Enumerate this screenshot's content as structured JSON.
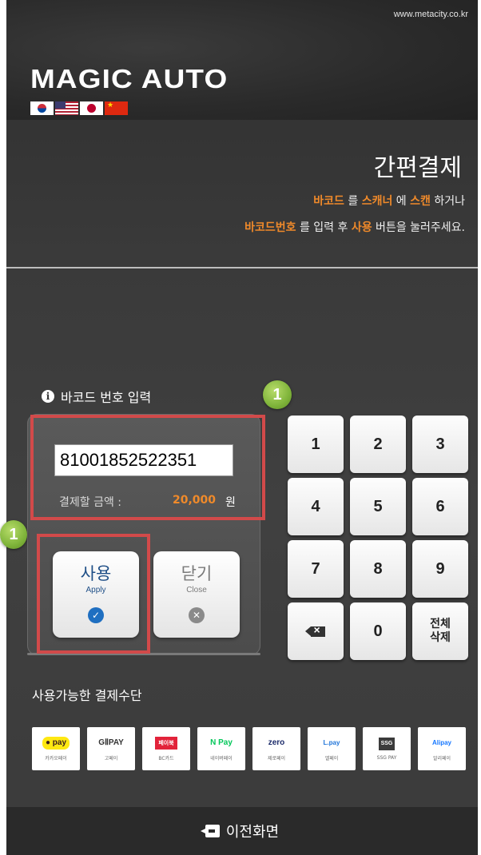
{
  "header": {
    "site_url": "www.metacity.co.kr",
    "logo_text": "MAGIC AUTO",
    "flags": [
      "korea-flag-icon",
      "usa-flag-icon",
      "japan-flag-icon",
      "china-flag-icon"
    ]
  },
  "title": "간편결제",
  "instructions": {
    "line1": {
      "w1": "바코드",
      "t1": " 를 ",
      "w2": "스캐너",
      "t2": " 에 ",
      "w3": "스캔",
      "t3": " 하거나"
    },
    "line2": {
      "w1": "바코드번호",
      "t1": " 를 입력 후 ",
      "w2": "사용",
      "t2": " 버튼을 눌러주세요."
    }
  },
  "barcode_section": {
    "label": "바코드 번호 입력",
    "value": "81001852522351",
    "amount_label": "결제할 금액 :",
    "amount_value": "20,000",
    "amount_unit": "원"
  },
  "buttons": {
    "apply": {
      "label": "사용",
      "sub": "Apply"
    },
    "close": {
      "label": "닫기",
      "sub": "Close"
    }
  },
  "keypad": {
    "keys": [
      "1",
      "2",
      "3",
      "4",
      "5",
      "6",
      "7",
      "8",
      "9",
      "0"
    ],
    "clear_all": "전체\n삭제"
  },
  "badges": [
    "1",
    "1"
  ],
  "payment": {
    "label": "사용가능한 결제수단",
    "methods": [
      {
        "logo": "● pay",
        "name": "카카오페이",
        "bg": "#ffe812",
        "color": "#3a1d1d"
      },
      {
        "logo": "GⅡPAY",
        "name": "고페이",
        "bg": "#ffffff",
        "color": "#333333"
      },
      {
        "logo": "페이북",
        "name": "BC카드",
        "bg": "#e2233a",
        "color": "#ffffff"
      },
      {
        "logo": "N Pay",
        "name": "네이버페이",
        "bg": "#ffffff",
        "color": "#03c75a"
      },
      {
        "logo": "zero",
        "name": "제로페이",
        "bg": "#ffffff",
        "color": "#1d2c6b"
      },
      {
        "logo": "L.pay",
        "name": "엘페이",
        "bg": "#ffffff",
        "color": "#1e73d8"
      },
      {
        "logo": "SSG",
        "name": "SSG PAY",
        "bg": "#3b3b3b",
        "color": "#ffffff"
      },
      {
        "logo": "Alipay",
        "name": "알리페이",
        "bg": "#ffffff",
        "color": "#1677ff"
      }
    ]
  },
  "footer": {
    "back_label": "이전화면"
  },
  "colors": {
    "accent_orange": "#f08a2a",
    "highlight_red": "#d24a4a",
    "badge_green": "#7fb43a",
    "apply_blue": "#1f6fc1"
  }
}
